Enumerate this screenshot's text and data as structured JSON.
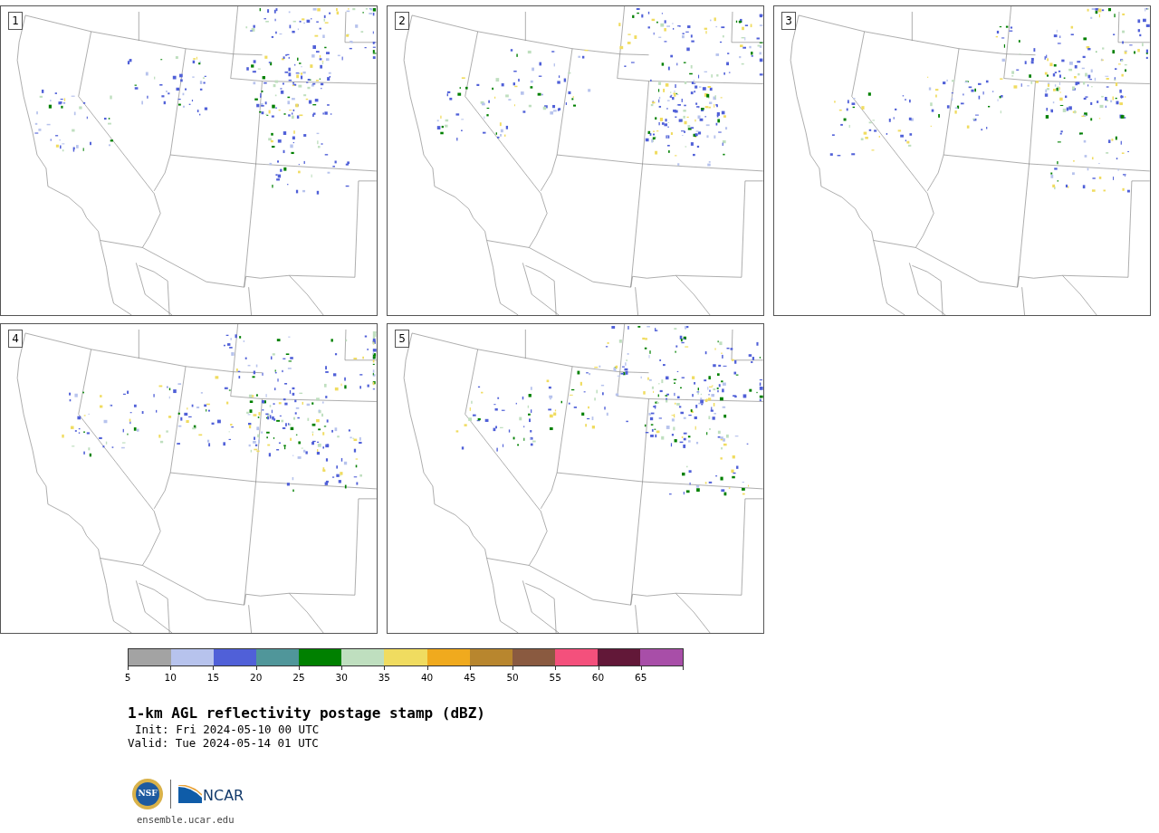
{
  "panels": [
    {
      "label": "1"
    },
    {
      "label": "2"
    },
    {
      "label": "3"
    },
    {
      "label": "4"
    },
    {
      "label": "5"
    }
  ],
  "colorbar": {
    "bins": [
      {
        "color": "#a3a3a3"
      },
      {
        "color": "#b7c3ed"
      },
      {
        "color": "#5060d8"
      },
      {
        "color": "#50969a"
      },
      {
        "color": "#008000"
      },
      {
        "color": "#bfdfbf"
      },
      {
        "color": "#f0dc60"
      },
      {
        "color": "#f0aa1e"
      },
      {
        "color": "#b8862e"
      },
      {
        "color": "#8a5a40"
      },
      {
        "color": "#f4507c"
      },
      {
        "color": "#621838"
      },
      {
        "color": "#a84ea8"
      }
    ],
    "ticks": [
      "5",
      "10",
      "15",
      "20",
      "25",
      "30",
      "35",
      "40",
      "45",
      "50",
      "55",
      "60",
      "65"
    ]
  },
  "title": "1-km AGL reflectivity postage stamp (dBZ)",
  "init": "Init: Fri 2024-05-10 00 UTC",
  "valid": "Valid: Tue 2024-05-14 01 UTC",
  "logo": {
    "seal_text": "NSF",
    "wordmark": "NCAR"
  },
  "url": "ensemble.ucar.edu"
}
